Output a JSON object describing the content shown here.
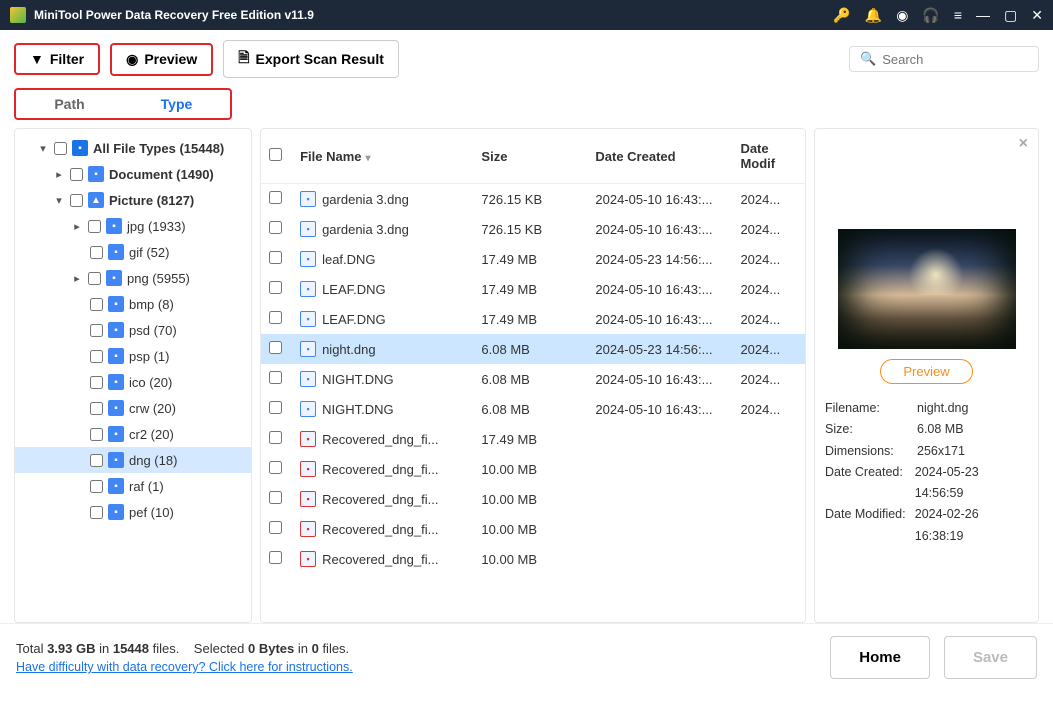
{
  "titlebar": {
    "title": "MiniTool Power Data Recovery Free Edition v11.9"
  },
  "toolbar": {
    "filter": "Filter",
    "preview": "Preview",
    "export": "Export Scan Result",
    "search_placeholder": "Search"
  },
  "tabs": {
    "path": "Path",
    "type": "Type"
  },
  "tree": [
    {
      "id": "all",
      "icon": "all",
      "label": "All File Types (15448)",
      "ind": 1,
      "bold": true,
      "chev": "▾"
    },
    {
      "id": "doc",
      "icon": "doc",
      "label": "Document (1490)",
      "ind": 2,
      "bold": true,
      "chev": "▸"
    },
    {
      "id": "pic",
      "icon": "pic",
      "label": "Picture (8127)",
      "ind": 2,
      "bold": true,
      "chev": "▾"
    },
    {
      "id": "jpg",
      "icon": "ft",
      "label": "jpg (1933)",
      "ind": 3,
      "chev": "▸"
    },
    {
      "id": "gif",
      "icon": "ft",
      "label": "gif (52)",
      "ind": 4
    },
    {
      "id": "png",
      "icon": "ft",
      "label": "png (5955)",
      "ind": 3,
      "chev": "▸"
    },
    {
      "id": "bmp",
      "icon": "ft",
      "label": "bmp (8)",
      "ind": 4
    },
    {
      "id": "psd",
      "icon": "ft",
      "label": "psd (70)",
      "ind": 4
    },
    {
      "id": "psp",
      "icon": "ft",
      "label": "psp (1)",
      "ind": 4
    },
    {
      "id": "ico",
      "icon": "ft",
      "label": "ico (20)",
      "ind": 4
    },
    {
      "id": "crw",
      "icon": "ft",
      "label": "crw (20)",
      "ind": 4
    },
    {
      "id": "cr2",
      "icon": "ft",
      "label": "cr2 (20)",
      "ind": 4
    },
    {
      "id": "dng",
      "icon": "ft",
      "label": "dng (18)",
      "ind": 4,
      "sel": true
    },
    {
      "id": "raf",
      "icon": "ft",
      "label": "raf (1)",
      "ind": 4
    },
    {
      "id": "pef",
      "icon": "ft",
      "label": "pef (10)",
      "ind": 4
    }
  ],
  "columns": {
    "name": "File Name",
    "size": "Size",
    "created": "Date Created",
    "modified": "Date Modif"
  },
  "files": [
    {
      "name": "gardenia 3.dng",
      "size": "726.15 KB",
      "created": "2024-05-10 16:43:...",
      "modified": "2024..."
    },
    {
      "name": "gardenia 3.dng",
      "size": "726.15 KB",
      "created": "2024-05-10 16:43:...",
      "modified": "2024..."
    },
    {
      "name": "leaf.DNG",
      "size": "17.49 MB",
      "created": "2024-05-23 14:56:...",
      "modified": "2024..."
    },
    {
      "name": "LEAF.DNG",
      "size": "17.49 MB",
      "created": "2024-05-10 16:43:...",
      "modified": "2024..."
    },
    {
      "name": "LEAF.DNG",
      "size": "17.49 MB",
      "created": "2024-05-10 16:43:...",
      "modified": "2024..."
    },
    {
      "name": "night.dng",
      "size": "6.08 MB",
      "created": "2024-05-23 14:56:...",
      "modified": "2024...",
      "sel": true
    },
    {
      "name": "NIGHT.DNG",
      "size": "6.08 MB",
      "created": "2024-05-10 16:43:...",
      "modified": "2024..."
    },
    {
      "name": "NIGHT.DNG",
      "size": "6.08 MB",
      "created": "2024-05-10 16:43:...",
      "modified": "2024..."
    },
    {
      "name": "Recovered_dng_fi...",
      "size": "17.49 MB",
      "created": "",
      "modified": "",
      "rec": true
    },
    {
      "name": "Recovered_dng_fi...",
      "size": "10.00 MB",
      "created": "",
      "modified": "",
      "rec": true
    },
    {
      "name": "Recovered_dng_fi...",
      "size": "10.00 MB",
      "created": "",
      "modified": "",
      "rec": true
    },
    {
      "name": "Recovered_dng_fi...",
      "size": "10.00 MB",
      "created": "",
      "modified": "",
      "rec": true
    },
    {
      "name": "Recovered_dng_fi...",
      "size": "10.00 MB",
      "created": "",
      "modified": "",
      "rec": true
    }
  ],
  "preview": {
    "button": "Preview",
    "meta": [
      {
        "k": "Filename:",
        "v": "night.dng"
      },
      {
        "k": "Size:",
        "v": "6.08 MB"
      },
      {
        "k": "Dimensions:",
        "v": "256x171"
      },
      {
        "k": "Date Created:",
        "v": "2024-05-23 14:56:59"
      },
      {
        "k": "Date Modified:",
        "v": "2024-02-26 16:38:19"
      }
    ]
  },
  "footer": {
    "total_a": "Total ",
    "total_b": "3.93 GB",
    "total_c": " in ",
    "total_d": "15448",
    "total_e": " files.",
    "sel_a": "Selected ",
    "sel_b": "0 Bytes",
    "sel_c": " in ",
    "sel_d": "0",
    "sel_e": " files.",
    "link": "Have difficulty with data recovery? Click here for instructions.",
    "home": "Home",
    "save": "Save"
  }
}
